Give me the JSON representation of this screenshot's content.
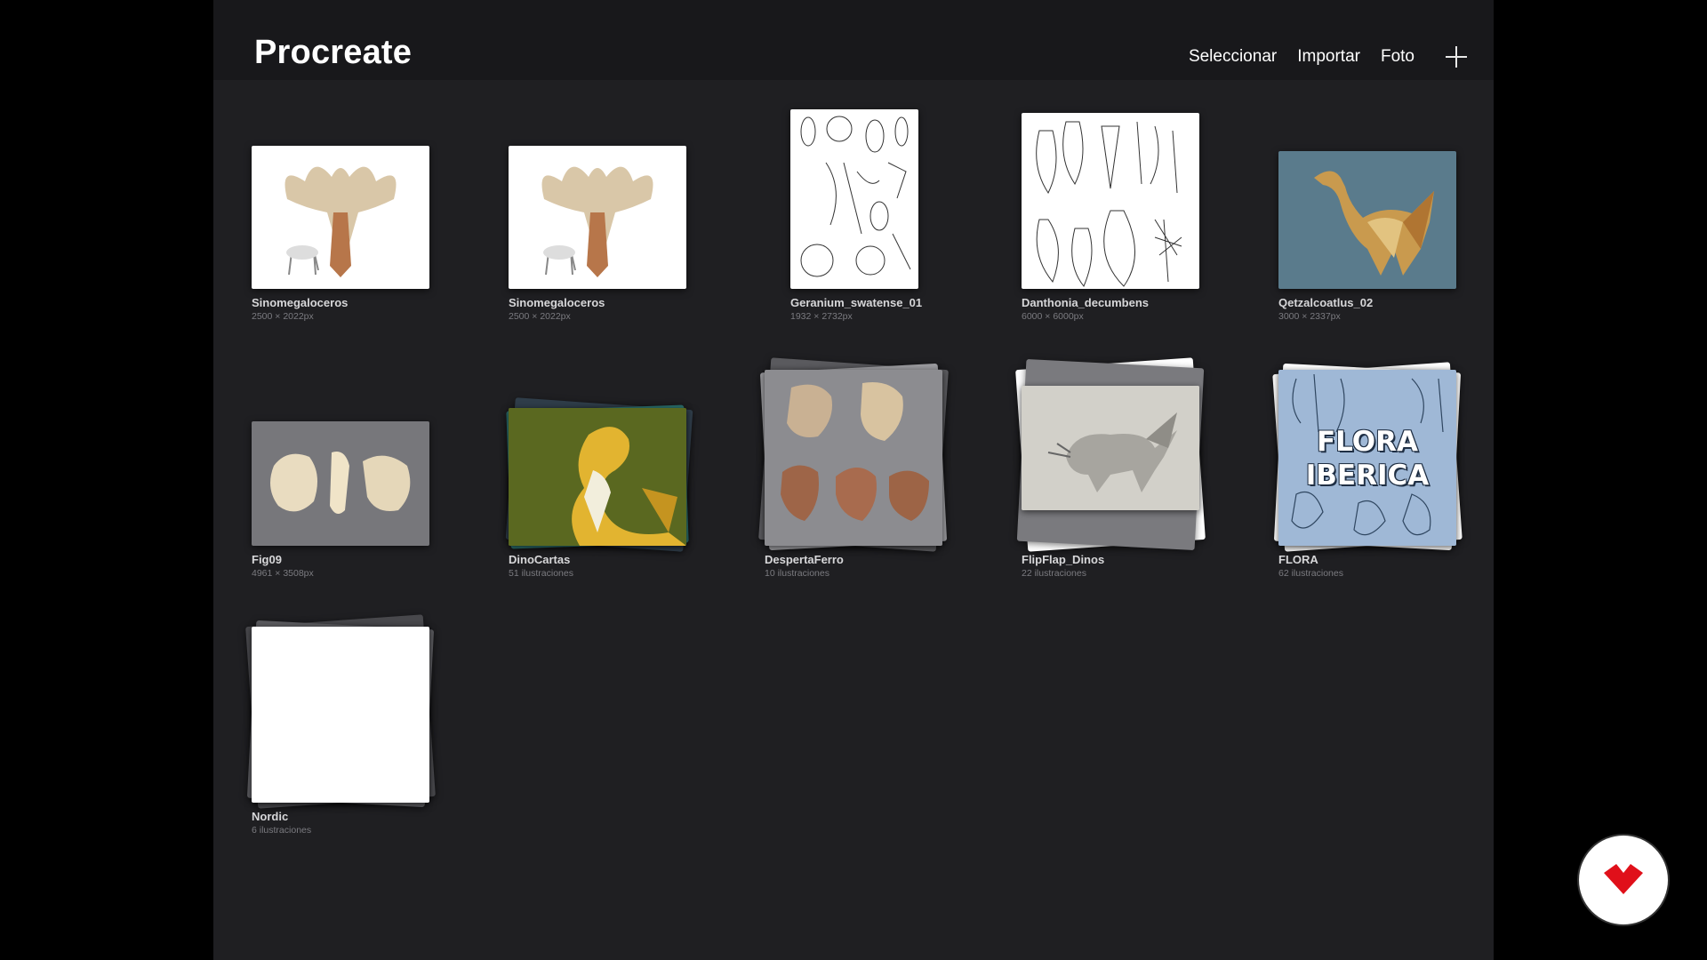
{
  "app": {
    "title": "Procreate"
  },
  "toolbar": {
    "select_label": "Seleccionar",
    "import_label": "Importar",
    "photo_label": "Foto",
    "new_icon": "plus-icon"
  },
  "gallery": {
    "items": [
      {
        "title": "Sinomegaloceros",
        "subtitle": "2500 × 2022px",
        "kind": "artwork",
        "background": "#ffffff"
      },
      {
        "title": "Sinomegaloceros",
        "subtitle": "2500 × 2022px",
        "kind": "artwork",
        "background": "#ffffff"
      },
      {
        "title": "Geranium_swatense_01",
        "subtitle": "1932 × 2732px",
        "kind": "artwork",
        "background": "#ffffff"
      },
      {
        "title": "Danthonia_decumbens",
        "subtitle": "6000 × 6000px",
        "kind": "artwork",
        "background": "#ffffff"
      },
      {
        "title": "Qetzalcoatlus_02",
        "subtitle": "3000 × 2337px",
        "kind": "artwork",
        "background": "#5a7b8c"
      },
      {
        "title": "Fig09",
        "subtitle": "4961 × 3508px",
        "kind": "artwork",
        "background": "#77777b"
      },
      {
        "title": "DinoCartas",
        "subtitle": "51 ilustraciones",
        "kind": "stack",
        "background": "#5d6a1e"
      },
      {
        "title": "DespertaFerro",
        "subtitle": "10 ilustraciones",
        "kind": "stack",
        "background": "#8c8c90"
      },
      {
        "title": "FlipFlap_Dinos",
        "subtitle": "22 ilustraciones",
        "kind": "stack",
        "background": "#cfcdc6"
      },
      {
        "title": "FLORA",
        "subtitle": "62 ilustraciones",
        "kind": "stack",
        "background": "#9fb8d6",
        "cover_text": [
          "FLORA",
          "IBERICA"
        ]
      },
      {
        "title": "Nordic",
        "subtitle": "6 ilustraciones",
        "kind": "stack",
        "background": "#ffffff"
      }
    ]
  },
  "fab": {
    "icon": "brand-logo-icon",
    "color": "#e0101a"
  }
}
